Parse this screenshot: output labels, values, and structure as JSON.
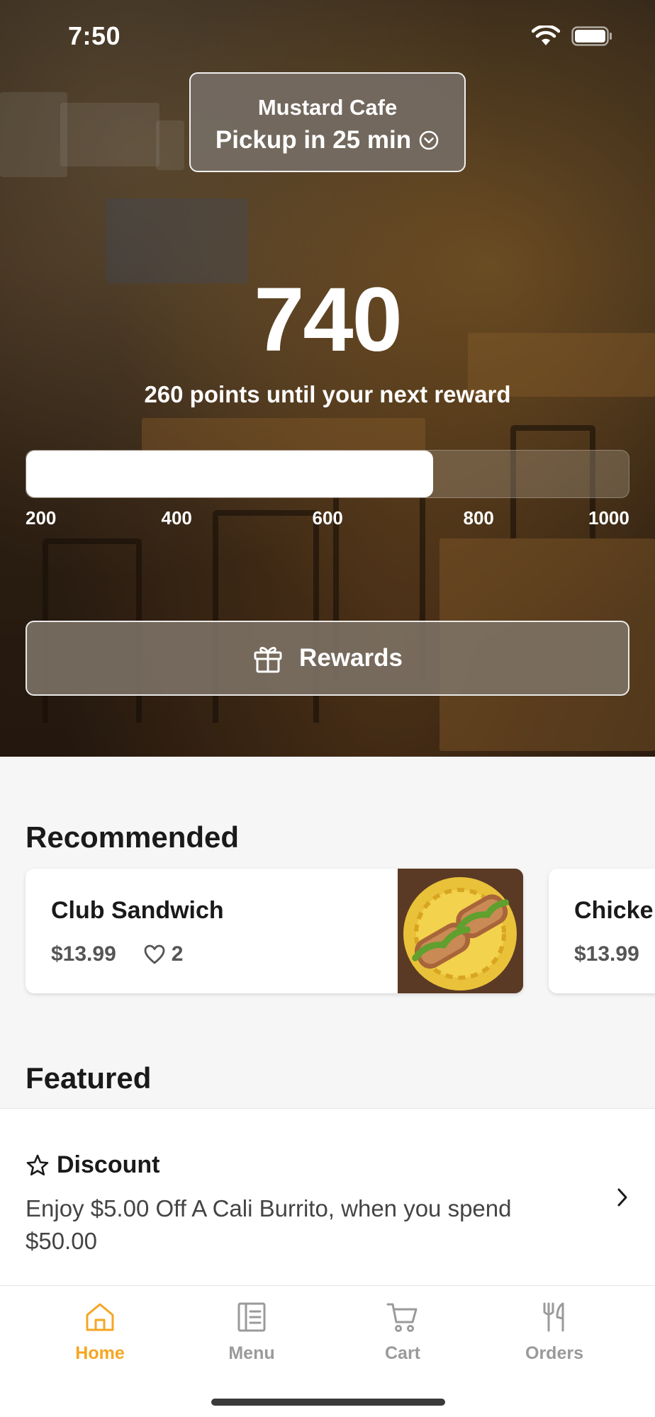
{
  "status_bar": {
    "time": "7:50"
  },
  "store": {
    "name": "Mustard Cafe",
    "pickup": "Pickup in 25 min"
  },
  "points": {
    "value": "740",
    "subtitle": "260 points until your next reward",
    "progress_fraction": 0.675,
    "ticks": [
      "200",
      "400",
      "600",
      "800",
      "1000"
    ]
  },
  "rewards_button": {
    "label": "Rewards"
  },
  "recommended": {
    "title": "Recommended",
    "items": [
      {
        "name": "Club Sandwich",
        "price": "$13.99",
        "likes": "2"
      },
      {
        "name": "Chicke",
        "price": "$13.99"
      }
    ]
  },
  "featured": {
    "title": "Featured",
    "item": {
      "heading": "Discount",
      "description": "Enjoy $5.00 Off A Cali Burrito, when you spend $50.00"
    }
  },
  "tabs": [
    {
      "label": "Home",
      "icon": "home-icon",
      "active": true
    },
    {
      "label": "Menu",
      "icon": "menu-icon",
      "active": false
    },
    {
      "label": "Cart",
      "icon": "cart-icon",
      "active": false
    },
    {
      "label": "Orders",
      "icon": "orders-icon",
      "active": false
    }
  ],
  "colors": {
    "accent": "#f5a623",
    "inactive_tab": "#9a9a9a"
  }
}
